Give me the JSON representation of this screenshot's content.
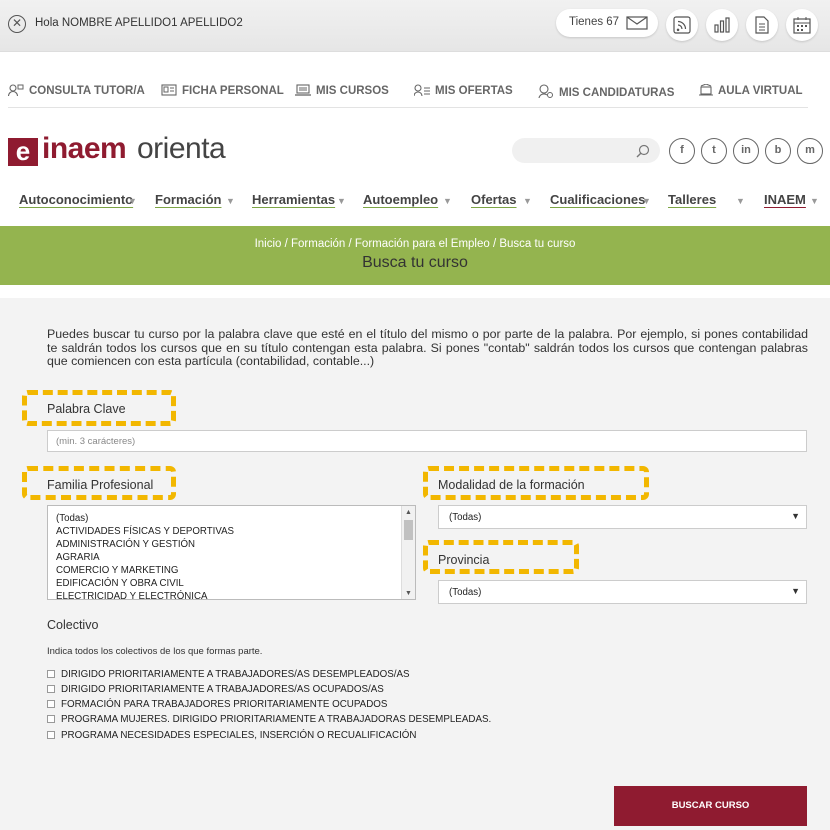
{
  "topbar": {
    "greeting": "Hola NOMBRE APELLIDO1 APELLIDO2",
    "messages_label": "Tienes 67",
    "icons": [
      "rss-icon",
      "chart-icon",
      "document-icon",
      "calendar-icon"
    ]
  },
  "nav": {
    "items": [
      {
        "label": "CONSULTA TUTOR/A",
        "icon": "tutor-icon"
      },
      {
        "label": "FICHA PERSONAL",
        "icon": "id-card-icon"
      },
      {
        "label": "MIS CURSOS",
        "icon": "laptop-icon"
      },
      {
        "label": "MIS OFERTAS",
        "icon": "offers-icon"
      },
      {
        "label": "MIS CANDIDATURAS",
        "icon": "candidature-icon"
      },
      {
        "label": "AULA VIRTUAL",
        "icon": "virtual-classroom-icon"
      }
    ]
  },
  "logo": {
    "e": "e",
    "inaem": "inaem",
    "orienta": "orienta"
  },
  "social": [
    "f",
    "t",
    "in",
    "b",
    "m"
  ],
  "menu": {
    "items": [
      "Autoconocimiento",
      "Formación",
      "Herramientas",
      "Autoempleo",
      "Ofertas",
      "Cualificaciones",
      "Talleres",
      "INAEM"
    ]
  },
  "banner": {
    "breadcrumb": "Inicio / Formación / Formación para el Empleo / Busca tu curso",
    "title": "Busca tu curso"
  },
  "form": {
    "intro": "Puedes buscar tu curso por la palabra clave que esté en el título del mismo o por parte de la palabra. Por ejemplo, si pones contabilidad te saldrán todos los cursos que en su título contengan esta palabra. Si pones \"contab\" saldrán todos los cursos que contengan palabras que comiencen con esta partícula (contabilidad, contable...)",
    "keyword_label": "Palabra Clave",
    "keyword_placeholder": "(min. 3 carácteres)",
    "familia_label": "Familia Profesional",
    "familia_options": [
      "(Todas)",
      "ACTIVIDADES FÍSICAS Y DEPORTIVAS",
      "ADMINISTRACIÓN Y GESTIÓN",
      "AGRARIA",
      "COMERCIO Y MARKETING",
      "EDIFICACIÓN Y OBRA CIVIL",
      "ELECTRICIDAD Y ELECTRÓNICA"
    ],
    "modalidad_label": "Modalidad de la formación",
    "modalidad_value": "(Todas)",
    "provincia_label": "Provincia",
    "provincia_value": "(Todas)",
    "colectivo_label": "Colectivo",
    "colectivo_hint": "Indica todos los colectivos de los que formas parte.",
    "colectivos": [
      "DIRIGIDO PRIORITARIAMENTE A TRABAJADORES/AS DESEMPLEADOS/AS",
      "DIRIGIDO PRIORITARIAMENTE A TRABAJADORES/AS OCUPADOS/AS",
      "FORMACIÓN PARA TRABAJADORES PRIORITARIAMENTE OCUPADOS",
      "PROGRAMA MUJERES. DIRIGIDO PRIORITARIAMENTE A TRABAJADORAS DESEMPLEADAS.",
      "PROGRAMA NECESIDADES ESPECIALES, INSERCIÓN O RECUALIFICACIÓN"
    ],
    "submit_label": "BUSCAR CURSO"
  },
  "colors": {
    "brand": "#8f1b30",
    "banner": "#94b44f",
    "highlight": "#f2b700",
    "menu_underline": "#7da544"
  }
}
